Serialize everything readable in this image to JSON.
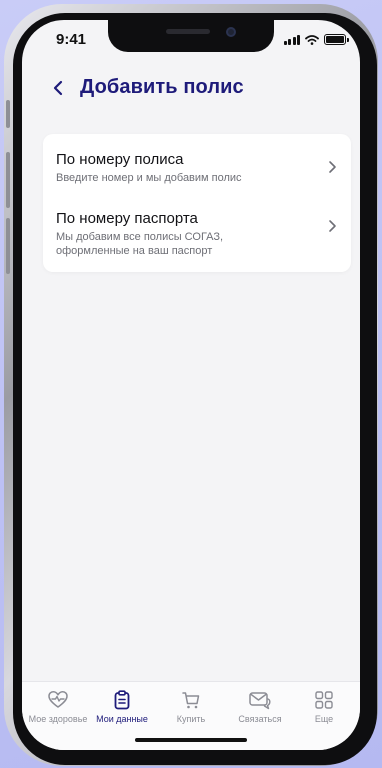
{
  "status_bar": {
    "time": "9:41"
  },
  "header": {
    "title": "Добавить полис"
  },
  "options": [
    {
      "title": "По номеру полиса",
      "subtitle": "Введите номер и мы добавим полис"
    },
    {
      "title": "По номеру паспорта",
      "subtitle": "Мы добавим все полисы СОГАЗ, оформленные на ваш паспорт"
    }
  ],
  "tabbar": {
    "items": [
      {
        "label": "Мое здоровье",
        "icon": "heart-pulse-icon"
      },
      {
        "label": "Мои данные",
        "icon": "clipboard-icon",
        "active": true
      },
      {
        "label": "Купить",
        "icon": "cart-icon"
      },
      {
        "label": "Связаться",
        "icon": "chat-mail-icon"
      },
      {
        "label": "Еще",
        "icon": "grid-icon"
      }
    ]
  },
  "colors": {
    "accent": "#1e1b7a",
    "inactive": "#8b8c94",
    "background": "#f4f4f6"
  }
}
